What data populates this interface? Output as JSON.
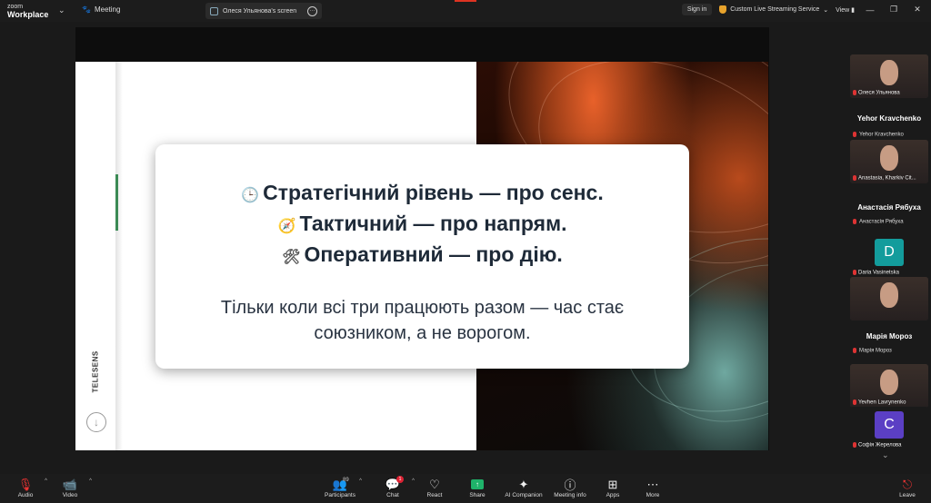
{
  "topbar": {
    "brand_line1": "zoom",
    "brand_line2": "Workplace",
    "meeting_label": "Meeting",
    "shared_screen_label": "Олеся Ульянова's screen",
    "sign_in": "Sign in",
    "streaming_label": "Custom Live Streaming Service",
    "view_label": "View"
  },
  "slide": {
    "vertical_brand": "TELESENS",
    "line1": "Стратегічний рівень — про сенс.",
    "line2": "Тактичний — про напрям.",
    "line3": "Оперативний — про дію.",
    "body": "Тільки коли всі три працюють разом — час стає союзником, а не ворогом."
  },
  "participants": [
    {
      "kind": "video",
      "name": "Олеся Ульянова"
    },
    {
      "kind": "heading",
      "name": "Yehor Kravchenko"
    },
    {
      "kind": "label",
      "name": "Yehor Kravchenko"
    },
    {
      "kind": "video",
      "name": "Anastasia, Kharkiv Cit..."
    },
    {
      "kind": "heading",
      "name": "Анастасія Рябуха"
    },
    {
      "kind": "label",
      "name": "Анастасія Рябуха"
    },
    {
      "kind": "avatar",
      "letter": "D",
      "color": "#139c9c",
      "name": "Daria Vasinetska"
    },
    {
      "kind": "video",
      "name": ""
    },
    {
      "kind": "heading",
      "name": "Марія Мороз"
    },
    {
      "kind": "label",
      "name": "Марія Мороз"
    },
    {
      "kind": "video",
      "name": "Yevhen Lavrynenko"
    },
    {
      "kind": "avatar",
      "letter": "C",
      "color": "#5b3fc4",
      "name": "Софія Жерелова"
    }
  ],
  "toolbar": {
    "audio": "Audio",
    "video": "Video",
    "participants": "Participants",
    "participants_count": "89",
    "chat": "Chat",
    "chat_badge": "1",
    "react": "React",
    "share": "Share",
    "ai_companion": "AI Companion",
    "meeting_info": "Meeting info",
    "apps": "Apps",
    "more": "More",
    "leave": "Leave"
  }
}
